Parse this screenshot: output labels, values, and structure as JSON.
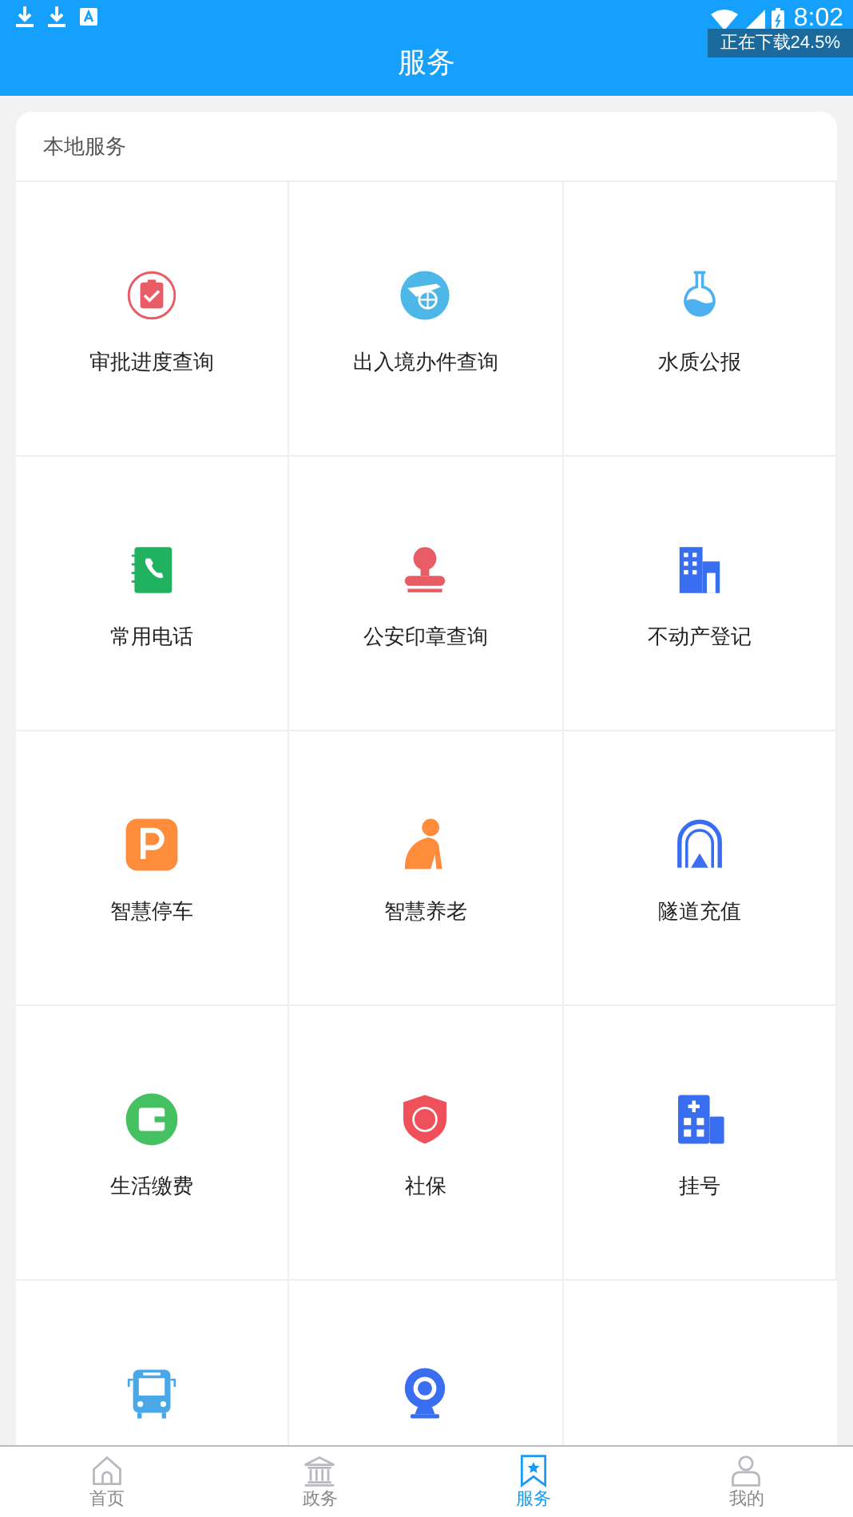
{
  "status_bar": {
    "time": "8:02",
    "download_toast": "正在下载24.5%"
  },
  "header": {
    "title": "服务"
  },
  "section": {
    "title": "本地服务",
    "items": [
      {
        "kind": "tile",
        "label": "审批进度查询"
      },
      {
        "kind": "tile",
        "label": "出入境办件查询"
      },
      {
        "kind": "tile",
        "label": "水质公报"
      },
      {
        "kind": "tile",
        "label": "常用电话"
      },
      {
        "kind": "tile",
        "label": "公安印章查询"
      },
      {
        "kind": "tile",
        "label": "不动产登记"
      },
      {
        "kind": "tile",
        "label": "智慧停车"
      },
      {
        "kind": "tile",
        "label": "智慧养老"
      },
      {
        "kind": "tile",
        "label": "隧道充值"
      },
      {
        "kind": "tile",
        "label": "生活缴费"
      },
      {
        "kind": "tile",
        "label": "社保"
      },
      {
        "kind": "tile",
        "label": "挂号"
      },
      {
        "kind": "cut_off"
      },
      {
        "kind": "cut_off"
      }
    ]
  },
  "tabs": [
    {
      "label": "首页",
      "selected": false
    },
    {
      "label": "政务",
      "selected": false
    },
    {
      "label": "服务",
      "selected": true
    },
    {
      "label": "我的",
      "selected": false
    }
  ]
}
